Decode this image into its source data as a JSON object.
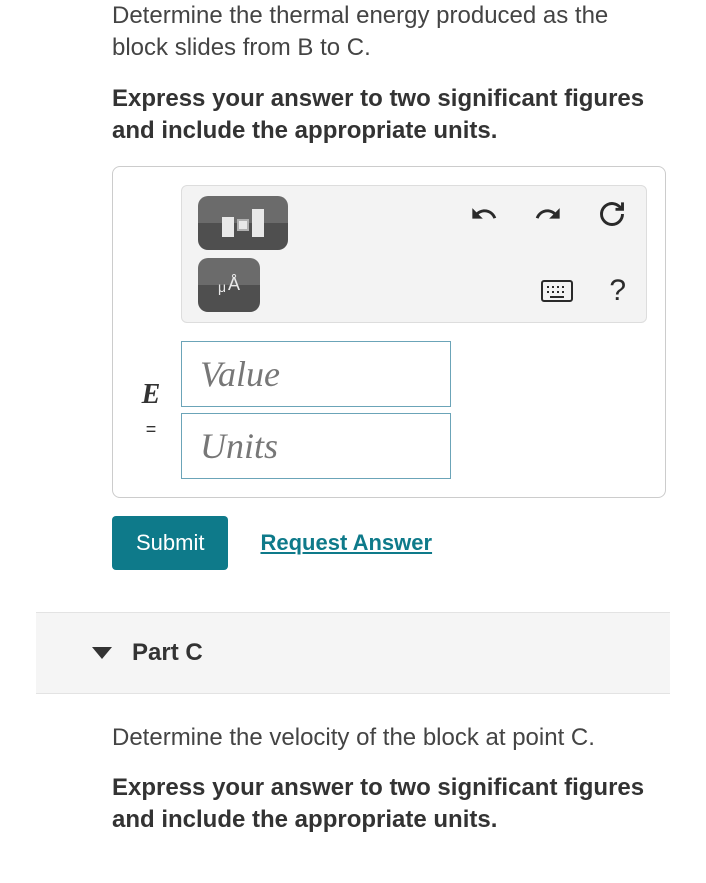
{
  "partB": {
    "question": "Determine the thermal energy produced as the block slides from B to C.",
    "instruction": "Express your answer to two significant figures and include the appropriate units.",
    "variable": "E",
    "equals": "=",
    "valuePlaceholder": "Value",
    "unitsPlaceholder": "Units",
    "submitLabel": "Submit",
    "requestLabel": "Request Answer"
  },
  "partC": {
    "title": "Part C",
    "question": "Determine the velocity of the block at point C.",
    "instruction": "Express your answer to two significant figures and include the appropriate units."
  },
  "toolbar": {
    "help": "?"
  }
}
